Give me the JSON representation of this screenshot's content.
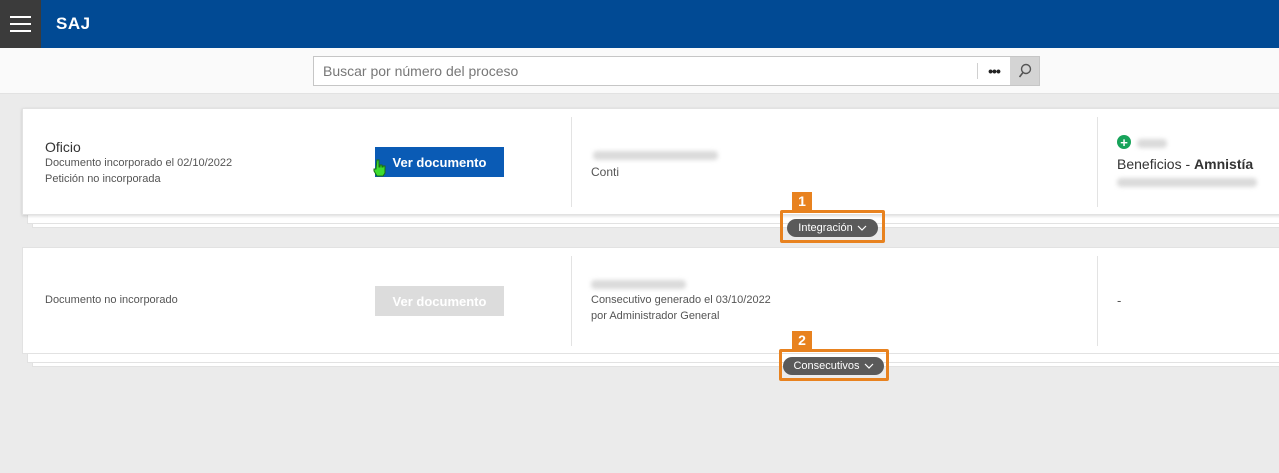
{
  "header": {
    "app_title": "SAJ",
    "menu_icon": "hamburger-icon"
  },
  "search": {
    "placeholder": "Buscar por número del proceso",
    "more_label": "•••",
    "search_icon": "search-icon"
  },
  "cards": [
    {
      "title": "Oficio",
      "line1": "Documento incorporado el 02/10/2022",
      "line2": "Petición no incorporada",
      "button_label": "Ver documento",
      "middle_line": "Conti",
      "right_title": "Beneficios",
      "right_separator": " - ",
      "right_bold": "Amnistía",
      "toggle_label": "Integración",
      "callout_number": "1"
    },
    {
      "line1": "Documento no incorporado",
      "button_label": "Ver documento",
      "middle_line1": "Consecutivo generado el 03/10/2022",
      "middle_line2": "por Administrador General",
      "right_value": "-",
      "toggle_label": "Consecutivos",
      "callout_number": "2"
    }
  ],
  "colors": {
    "header": "#014a94",
    "accent": "#0a5bb5",
    "callout": "#e8821f",
    "add": "#17a35a"
  }
}
